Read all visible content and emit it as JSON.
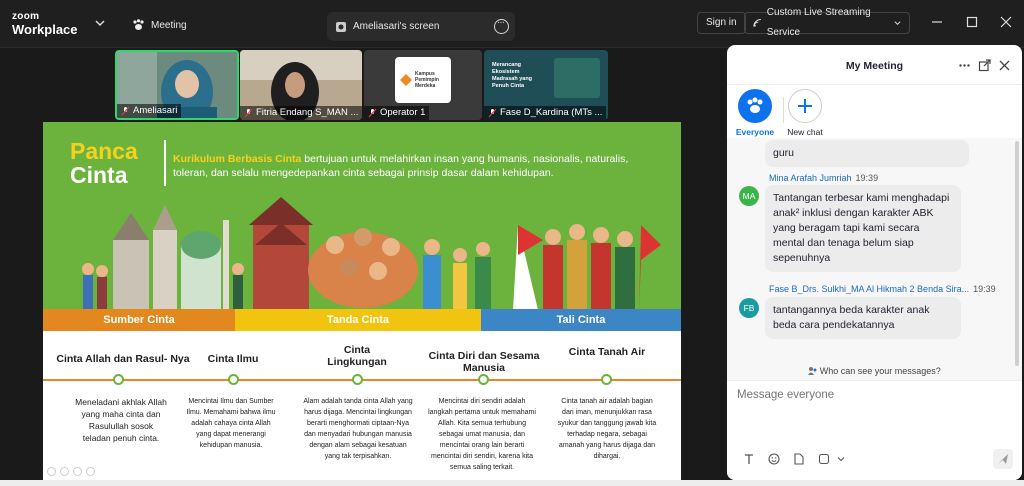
{
  "topbar": {
    "brand_top": "zoom",
    "brand_bottom": "Workplace",
    "meeting_tab": "Meeting",
    "screen_tab": "Ameliasari's screen",
    "signin": "Sign in",
    "stream": "Custom Live Streaming Service"
  },
  "thumbnails": [
    {
      "name": "Ameliasari"
    },
    {
      "name": "Fitria Endang S_MAN ..."
    },
    {
      "name": "Operator 1",
      "logo_line1": "Kampus",
      "logo_line2": "Pemimpin",
      "logo_line3": "Merdeka"
    },
    {
      "name": "Fase D_Kardina (MTs ...",
      "slide_lines": [
        "Merancang",
        "Ekosistem",
        "Madrasah yang",
        "Penuh Cinta"
      ]
    }
  ],
  "slide": {
    "panca": "Panca",
    "cinta": "Cinta",
    "highlight": "Kurikulum Berbasis Cinta",
    "description": " bertujuan untuk melahirkan insan yang humanis, nasionalis, naturalis, toleran, dan selalu mengedepankan cinta sebagai prinsip dasar dalam kehidupan.",
    "bands": [
      "Sumber Cinta",
      "Tanda Cinta",
      "Tali Cinta"
    ],
    "columns": [
      {
        "title": "Cinta Allah dan Rasul- Nya",
        "body": "Meneladani akhlak Allah yang maha cinta dan Rasulullah sosok teladan penuh cinta."
      },
      {
        "title": "Cinta Ilmu",
        "body": "Mencintai Ilmu dan Sumber Ilmu. Memahami bahwa ilmu adalah cahaya cinta Allah yang dapat menerangi kehidupan manusia."
      },
      {
        "title": "Cinta Lingkungan",
        "body": "Alam adalah tanda cinta Allah yang harus dijaga. Mencintai lingkungan berarti menghormati ciptaan-Nya dan menyadari hubungan manusia dengan alam sebagai kesatuan yang tak terpisahkan."
      },
      {
        "title": "Cinta Diri dan Sesama Manusia",
        "body": "Mencintai diri sendiri adalah langkah pertama untuk memahami Allah. Kita semua terhubung sebagai umat manusia, dan mencintai orang lain berarti mencintai diri sendiri, karena kita semua saling terkait."
      },
      {
        "title": "Cinta Tanah Air",
        "body": "Cinta tanah air adalah bagian dari iman, menunjukkan rasa syukur dan tanggung jawab kita terhadap negara, sebagai amanah yang harus dijaga dan dihargai."
      }
    ]
  },
  "panel": {
    "title": "My Meeting",
    "recipients": [
      {
        "label": "Everyone"
      },
      {
        "label": "New chat"
      }
    ],
    "messages": [
      {
        "text": "guru"
      },
      {
        "sender": "Mina Arafah Jumriah",
        "time": "19:39",
        "initials": "MA",
        "avatar_color": "#3bb54a",
        "text": "Tantangan terbesar kami menghadapi anak² inklusi dengan karakter ABK yang beragam tapi kami secara mental dan tenaga belum siap sepenuhnya"
      },
      {
        "sender": "Fase B_Drs. Sulkhi_MA Al Hikmah 2 Benda Sira...",
        "time": "19:39",
        "initials": "FB",
        "avatar_color": "#1a9ba0",
        "text": "tantangannya beda karakter anak beda cara pendekatannya"
      }
    ],
    "who_can_see": "Who can see your messages?",
    "message_placeholder": "Message everyone"
  }
}
